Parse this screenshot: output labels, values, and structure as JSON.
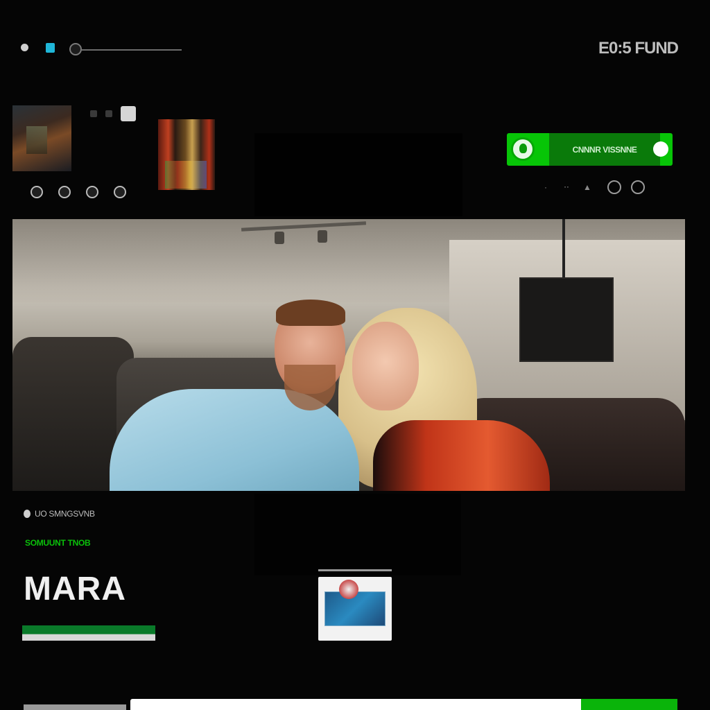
{
  "header": {
    "clock": "E0:5 FUND",
    "seek_progress": 0
  },
  "call_bar": {
    "label": "CNNNR VISSNNE"
  },
  "info": {
    "status_text": "UO SMNGSVNB",
    "green_text": "SOMUUNT TNOB",
    "name": "MARA"
  },
  "controls": [
    "·",
    "⋅⋅",
    "▲"
  ],
  "colors": {
    "accent_green": "#07c507",
    "background": "#050505",
    "cyan": "#1fb6d8"
  },
  "icons": {
    "call_left": "phone-icon",
    "call_right": "record-icon"
  }
}
